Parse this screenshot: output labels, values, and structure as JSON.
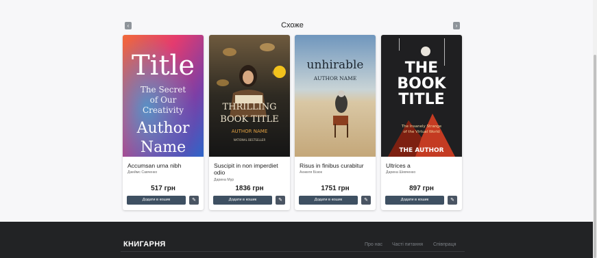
{
  "section": {
    "title": "Схоже",
    "prev_glyph": "‹",
    "next_glyph": "›"
  },
  "books": [
    {
      "cover": {
        "line1": "Title",
        "line2": "The Secret",
        "line3": "of Our",
        "line4": "Creativity",
        "line5": "Author",
        "line6": "Name"
      },
      "title": "Accumsan urna nibh",
      "author": "Джеймс Савченко",
      "price": "517 грн",
      "cart_label": "Додати в кошик"
    },
    {
      "cover": {
        "line1": "THRILLING",
        "line2": "BOOK TITLE",
        "line3": "AUTHOR NAME",
        "line4": "NATIONAL BESTSELLER"
      },
      "title": "Suscipit in non imperdiet odio",
      "author": "Дарина Мур",
      "price": "1836 грн",
      "cart_label": "Додати в кошик"
    },
    {
      "cover": {
        "line1": "unhirable",
        "line2": "AUTHOR NAME"
      },
      "title": "Risus in finibus curabitur",
      "author": "Анжеля Бізюк",
      "price": "1751 грн",
      "cart_label": "Додати в кошик"
    },
    {
      "cover": {
        "line1": "THE",
        "line2": "BOOK",
        "line3": "TITLE",
        "line4": "The Insanely Strange",
        "line5": "of the Virtual World",
        "line6": "THE AUTHOR"
      },
      "title": "Ultrices a",
      "author": "Дарина Шевченко",
      "price": "897 грн",
      "cart_label": "Додати в кошик"
    }
  ],
  "footer": {
    "brand": "КНИГАРНЯ",
    "links": [
      "Про нас",
      "Часті питання",
      "Співпраця"
    ]
  },
  "icons": {
    "edit": "pencil-icon",
    "prev": "chevron-left-icon",
    "next": "chevron-right-icon"
  },
  "colors": {
    "button": "#3e5062",
    "footer_bg": "#222325"
  }
}
